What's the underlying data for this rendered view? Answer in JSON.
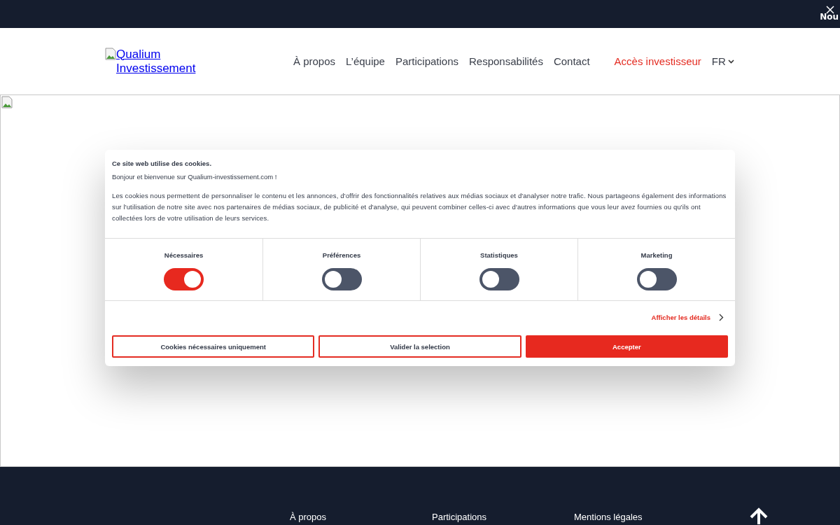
{
  "top_bar": {
    "text": "Nou"
  },
  "header": {
    "logo_alt": "Qualium Investissement",
    "nav": [
      {
        "label": "À propos",
        "kind": "link"
      },
      {
        "label": "L’équipe",
        "kind": "link"
      },
      {
        "label": "Participations",
        "kind": "link"
      },
      {
        "label": "Responsabilités",
        "kind": "link"
      },
      {
        "label": "Contact",
        "kind": "link"
      },
      {
        "label": "Accès investisseur",
        "kind": "highlight"
      }
    ],
    "language": "FR"
  },
  "cookie_dialog": {
    "title": "Ce site web utilise des cookies.",
    "greeting": "Bonjour et bienvenue sur Qualium-investissement.com !",
    "body": "Les cookies nous permettent de personnaliser le contenu et les annonces, d'offrir des fonctionnalités relatives aux médias sociaux et d'analyser notre trafic. Nous partageons également des informations sur l'utilisation de notre site avec nos partenaires de médias sociaux, de publicité et d'analyse, qui peuvent combiner celles-ci avec d'autres informations que vous leur avez fournies ou qu'ils ont collectées lors de votre utilisation de leurs services.",
    "toggles": [
      {
        "label": "Nécessaires",
        "on": true
      },
      {
        "label": "Préférences",
        "on": false
      },
      {
        "label": "Statistiques",
        "on": false
      },
      {
        "label": "Marketing",
        "on": false
      }
    ],
    "details_link": "Afficher les détails",
    "buttons": [
      {
        "label": "Cookies nécessaires uniquement",
        "kind": "outline"
      },
      {
        "label": "Valider la selection",
        "kind": "outline"
      },
      {
        "label": "Accepter",
        "kind": "primary"
      }
    ]
  },
  "footer": {
    "links": [
      "À propos",
      "Participations",
      "Mentions légales"
    ]
  }
}
